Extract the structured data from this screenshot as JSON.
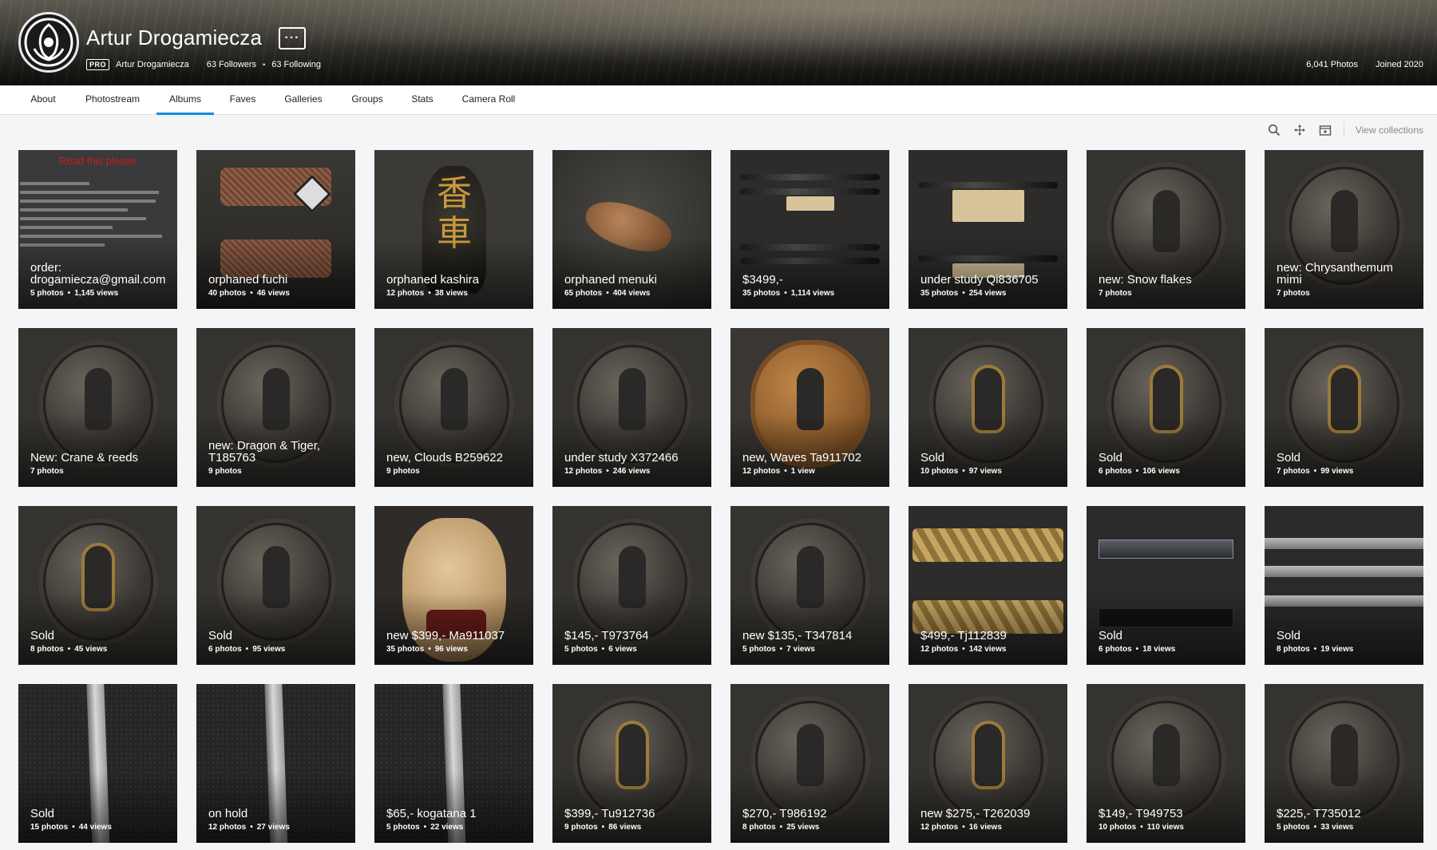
{
  "profile": {
    "name": "Artur Drogamiecza",
    "pro_badge": "PRO",
    "username": "Artur Drogamiecza",
    "followers": "63 Followers",
    "following": "63 Following",
    "separator": "•",
    "photos_count": "6,041 Photos",
    "joined": "Joined 2020",
    "more_label": "···"
  },
  "tabs": [
    {
      "label": "About",
      "active": false
    },
    {
      "label": "Photostream",
      "active": false
    },
    {
      "label": "Albums",
      "active": true
    },
    {
      "label": "Faves",
      "active": false
    },
    {
      "label": "Galleries",
      "active": false
    },
    {
      "label": "Groups",
      "active": false
    },
    {
      "label": "Stats",
      "active": false
    },
    {
      "label": "Camera Roll",
      "active": false
    }
  ],
  "toolbar": {
    "icons": [
      "search-icon",
      "move-icon",
      "archive-icon"
    ],
    "view_collections": "View collections"
  },
  "thumb_texts": {
    "order_heading": "Read this please",
    "kashira_kanji": "香車"
  },
  "albums": [
    {
      "title": "order: drogamiecza@gmail.com",
      "photos": "5 photos",
      "views": "1,145 views",
      "art": "doc"
    },
    {
      "title": "orphaned fuchi",
      "photos": "40 photos",
      "views": "46 views",
      "art": "fuchi"
    },
    {
      "title": "orphaned kashira",
      "photos": "12 photos",
      "views": "38 views",
      "art": "kashira"
    },
    {
      "title": "orphaned menuki",
      "photos": "65 photos",
      "views": "404 views",
      "art": "menuki"
    },
    {
      "title": "$3499,-",
      "photos": "35 photos",
      "views": "1,114 views",
      "art": "swords"
    },
    {
      "title": "under study Qi836705",
      "photos": "35 photos",
      "views": "254 views",
      "art": "swords2"
    },
    {
      "title": "new: Snow flakes",
      "photos": "7 photos",
      "views": "",
      "art": "tsuba"
    },
    {
      "title": "new: Chrysanthemum mimi",
      "photos": "7 photos",
      "views": "",
      "art": "tsuba"
    },
    {
      "title": "New: Crane & reeds",
      "photos": "7 photos",
      "views": "",
      "art": "tsuba"
    },
    {
      "title": "new: Dragon & Tiger, T185763",
      "photos": "9 photos",
      "views": "",
      "art": "tsuba"
    },
    {
      "title": "new, Clouds B259622",
      "photos": "9 photos",
      "views": "",
      "art": "tsuba"
    },
    {
      "title": "under study X372466",
      "photos": "12 photos",
      "views": "246 views",
      "art": "tsuba"
    },
    {
      "title": "new, Waves Ta911702",
      "photos": "12 photos",
      "views": "1 view",
      "art": "copper"
    },
    {
      "title": "Sold",
      "photos": "10 photos",
      "views": "97 views",
      "art": "tsuba-gold"
    },
    {
      "title": "Sold",
      "photos": "6 photos",
      "views": "106 views",
      "art": "tsuba-gold"
    },
    {
      "title": "Sold",
      "photos": "7 photos",
      "views": "99 views",
      "art": "tsuba-gold"
    },
    {
      "title": "Sold",
      "photos": "8 photos",
      "views": "45 views",
      "art": "tsuba-gold"
    },
    {
      "title": "Sold",
      "photos": "6 photos",
      "views": "95 views",
      "art": "tsuba"
    },
    {
      "title": "new $399,- Ma911037",
      "photos": "35 photos",
      "views": "96 views",
      "art": "mask"
    },
    {
      "title": "$145,- T973764",
      "photos": "5 photos",
      "views": "6 views",
      "art": "tsuba"
    },
    {
      "title": "new $135,- T347814",
      "photos": "5 photos",
      "views": "7 views",
      "art": "tsuba"
    },
    {
      "title": "$499,- Tj112839",
      "photos": "12 photos",
      "views": "142 views",
      "art": "tsuka"
    },
    {
      "title": "Sold",
      "photos": "6 photos",
      "views": "18 views",
      "art": "kozuka"
    },
    {
      "title": "Sold",
      "photos": "8 photos",
      "views": "19 views",
      "art": "blades"
    },
    {
      "title": "Sold",
      "photos": "15 photos",
      "views": "44 views",
      "art": "blade"
    },
    {
      "title": "on hold",
      "photos": "12 photos",
      "views": "27 views",
      "art": "blade"
    },
    {
      "title": "$65,- kogatana 1",
      "photos": "5 photos",
      "views": "22 views",
      "art": "blade"
    },
    {
      "title": "$399,- Tu912736",
      "photos": "9 photos",
      "views": "86 views",
      "art": "tsuba-gold"
    },
    {
      "title": "$270,- T986192",
      "photos": "8 photos",
      "views": "25 views",
      "art": "tsuba"
    },
    {
      "title": "new $275,- T262039",
      "photos": "12 photos",
      "views": "16 views",
      "art": "tsuba-gold"
    },
    {
      "title": "$149,- T949753",
      "photos": "10 photos",
      "views": "110 views",
      "art": "tsuba"
    },
    {
      "title": "$225,- T735012",
      "photos": "5 photos",
      "views": "33 views",
      "art": "tsuba"
    }
  ]
}
